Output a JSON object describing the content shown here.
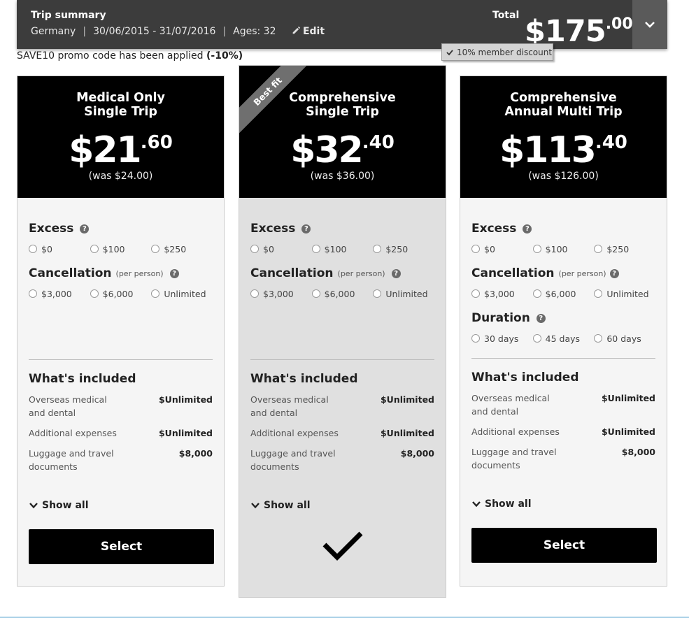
{
  "summary": {
    "title": "Trip summary",
    "destination": "Germany",
    "dates": "30/06/2015 - 31/07/2016",
    "ages": "Ages: 32",
    "edit_label": "Edit",
    "total_label": "Total",
    "total_dollars": "$175",
    "total_cents": ".00",
    "member_discount": "10% member discount"
  },
  "promo": {
    "text": "SAVE10 promo code has been applied ",
    "discount": "(-10%)"
  },
  "labels": {
    "excess": "Excess",
    "cancellation": "Cancellation",
    "per_person": "(per person)",
    "duration": "Duration",
    "whats_included": "What's included",
    "show_all": "Show all",
    "select": "Select",
    "help": "?"
  },
  "plans": [
    {
      "name_line1": "Medical Only",
      "name_line2": "Single Trip",
      "price_dollars": "$21",
      "price_cents": ".60",
      "was": "(was $24.00)",
      "excess_options": [
        "$0",
        "$100",
        "$250"
      ],
      "cancellation_options": [
        "$3,000",
        "$6,000",
        "Unlimited"
      ],
      "included": [
        {
          "label_line1": "Overseas medical",
          "label_line2": "and dental",
          "value": "$Unlimited"
        },
        {
          "label_line1": "Additional expenses",
          "label_line2": "",
          "value": "$Unlimited"
        },
        {
          "label_line1": "Luggage and travel",
          "label_line2": "documents",
          "value": "$8,000"
        }
      ],
      "selected": false
    },
    {
      "name_line1": "Comprehensive",
      "name_line2": "Single Trip",
      "price_dollars": "$32",
      "price_cents": ".40",
      "was": "(was $36.00)",
      "ribbon": "Best fit",
      "excess_options": [
        "$0",
        "$100",
        "$250"
      ],
      "cancellation_options": [
        "$3,000",
        "$6,000",
        "Unlimited"
      ],
      "included": [
        {
          "label_line1": "Overseas medical",
          "label_line2": "and dental",
          "value": "$Unlimited"
        },
        {
          "label_line1": "Additional expenses",
          "label_line2": "",
          "value": "$Unlimited"
        },
        {
          "label_line1": "Luggage and travel",
          "label_line2": "documents",
          "value": "$8,000"
        }
      ],
      "selected": true
    },
    {
      "name_line1": "Comprehensive",
      "name_line2": "Annual Multi Trip",
      "price_dollars": "$113",
      "price_cents": ".40",
      "was": "(was $126.00)",
      "excess_options": [
        "$0",
        "$100",
        "$250"
      ],
      "cancellation_options": [
        "$3,000",
        "$6,000",
        "Unlimited"
      ],
      "duration_options": [
        "30 days",
        "45 days",
        "60 days"
      ],
      "included": [
        {
          "label_line1": "Overseas medical",
          "label_line2": "and dental",
          "value": "$Unlimited"
        },
        {
          "label_line1": "Additional expenses",
          "label_line2": "",
          "value": "$Unlimited"
        },
        {
          "label_line1": "Luggage and travel",
          "label_line2": "documents",
          "value": "$8,000"
        }
      ],
      "selected": false
    }
  ]
}
